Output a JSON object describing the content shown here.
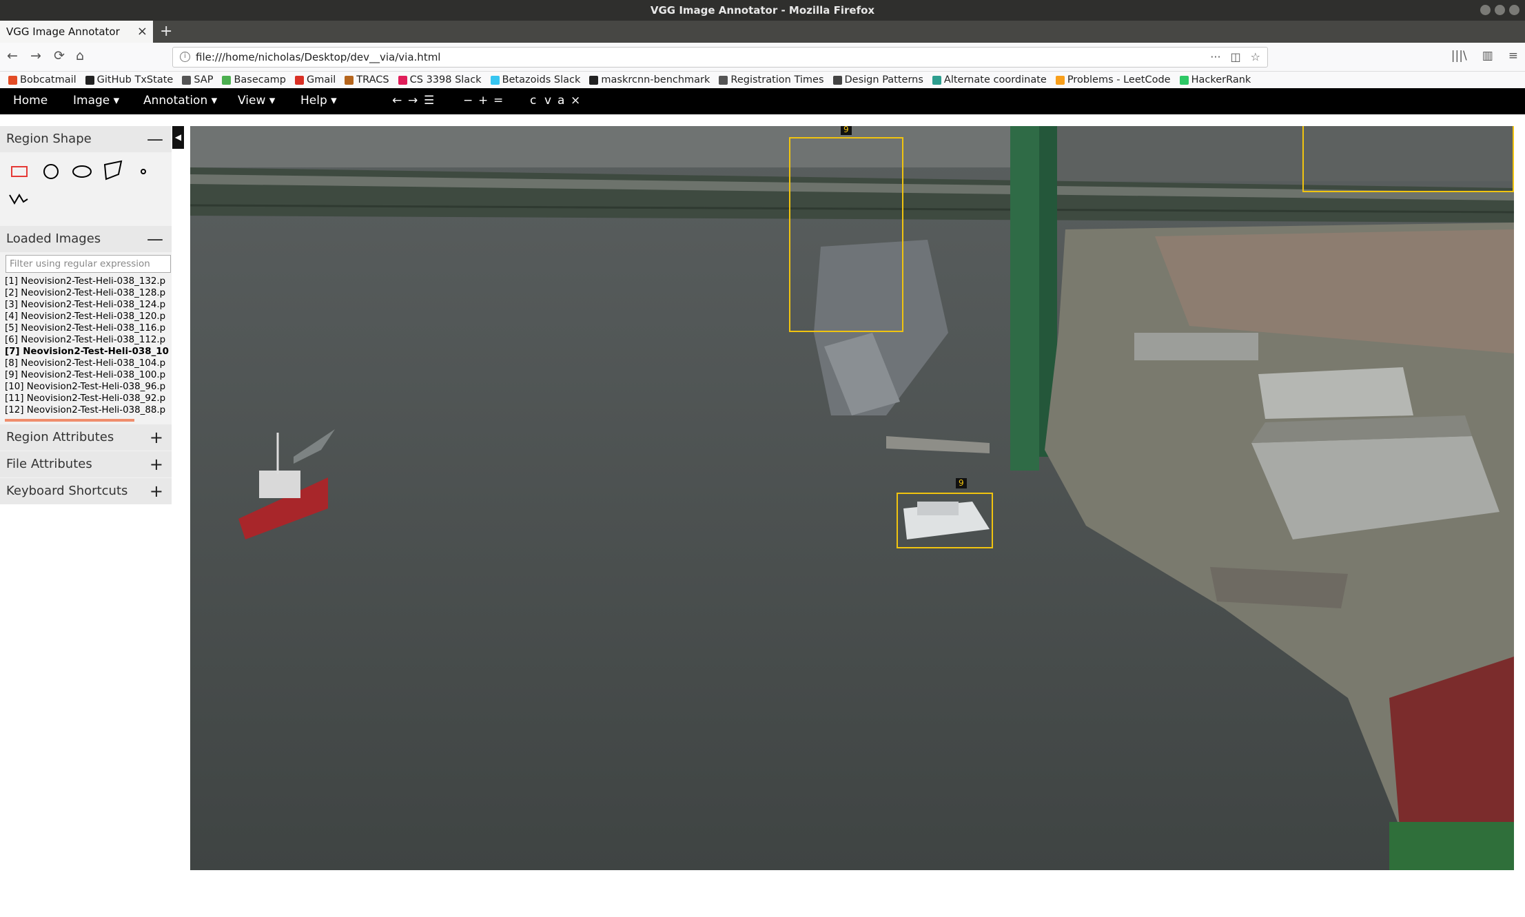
{
  "window": {
    "title": "VGG Image Annotator - Mozilla Firefox"
  },
  "tab": {
    "title": "VGG Image Annotator",
    "close": "×",
    "new_tab": "+"
  },
  "nav": {
    "back": "←",
    "forward": "→",
    "reload": "⟳",
    "home": "⌂",
    "info": "i",
    "url": "file:///home/nicholas/Desktop/dev__via/via.html",
    "more": "···",
    "pocket": "◫",
    "star": "☆",
    "library": "|||\\",
    "sidebar": "▥",
    "menu": "≡"
  },
  "bookmarks": [
    {
      "label": "Bobcatmail",
      "icon": "bobcatmail-icon",
      "color": "#e34c26"
    },
    {
      "label": "GitHub TxState",
      "icon": "github-icon",
      "color": "#222222"
    },
    {
      "label": "SAP",
      "icon": "star-icon",
      "color": "#555555"
    },
    {
      "label": "Basecamp",
      "icon": "basecamp-icon",
      "color": "#4caf50"
    },
    {
      "label": "Gmail",
      "icon": "gmail-icon",
      "color": "#d93025"
    },
    {
      "label": "TRACS",
      "icon": "tracs-icon",
      "color": "#b5651d"
    },
    {
      "label": "CS 3398 Slack",
      "icon": "slack-icon",
      "color": "#e01e5a"
    },
    {
      "label": "Betazoids Slack",
      "icon": "slack-icon",
      "color": "#36c5f0"
    },
    {
      "label": "maskrcnn-benchmark",
      "icon": "github-icon",
      "color": "#222222"
    },
    {
      "label": "Registration Times",
      "icon": "star-icon",
      "color": "#555555"
    },
    {
      "label": "Design Patterns",
      "icon": "pattern-icon",
      "color": "#444444"
    },
    {
      "label": "Alternate coordinate",
      "icon": "wolfram-icon",
      "color": "#2e9e8f"
    },
    {
      "label": "Problems - LeetCode",
      "icon": "leetcode-icon",
      "color": "#f89f1b"
    },
    {
      "label": "HackerRank",
      "icon": "hackerrank-icon",
      "color": "#2ec866"
    }
  ],
  "menubar": {
    "home": "Home",
    "image": "Image ▾",
    "annotation": "Annotation ▾",
    "view": "View ▾",
    "help": "Help ▾",
    "prev": "←",
    "next": "→",
    "list": "☰",
    "zoom_out": "−",
    "zoom_in": "+",
    "zoom_reset": "=",
    "copy": "c",
    "paste": "v",
    "select_all": "a",
    "delete": "×"
  },
  "panel": {
    "region_shape": {
      "title": "Region Shape",
      "toggle": "—"
    },
    "loaded_images": {
      "title": "Loaded Images",
      "toggle": "—",
      "filter_placeholder": "Filter using regular expression",
      "items": [
        "[1] Neovision2-Test-Heli-038_132.p",
        "[2] Neovision2-Test-Heli-038_128.p",
        "[3] Neovision2-Test-Heli-038_124.p",
        "[4] Neovision2-Test-Heli-038_120.p",
        "[5] Neovision2-Test-Heli-038_116.p",
        "[6] Neovision2-Test-Heli-038_112.p",
        "[7] Neovision2-Test-Heli-038_10",
        "[8] Neovision2-Test-Heli-038_104.p",
        "[9] Neovision2-Test-Heli-038_100.p",
        "[10] Neovision2-Test-Heli-038_96.p",
        "[11] Neovision2-Test-Heli-038_92.p",
        "[12] Neovision2-Test-Heli-038_88.p"
      ],
      "selected_index": 6
    },
    "region_attributes": {
      "title": "Region Attributes",
      "toggle": "+"
    },
    "file_attributes": {
      "title": "File Attributes",
      "toggle": "+"
    },
    "keyboard_shortcuts": {
      "title": "Keyboard Shortcuts",
      "toggle": "+"
    },
    "collapse": "◀"
  },
  "regions": [
    {
      "label": "9"
    },
    {
      "label": "9"
    },
    {
      "label": ""
    }
  ],
  "colors": {
    "region_stroke": "#f1c40f",
    "accent": "#ef8d6c",
    "menubar": "#000000"
  }
}
